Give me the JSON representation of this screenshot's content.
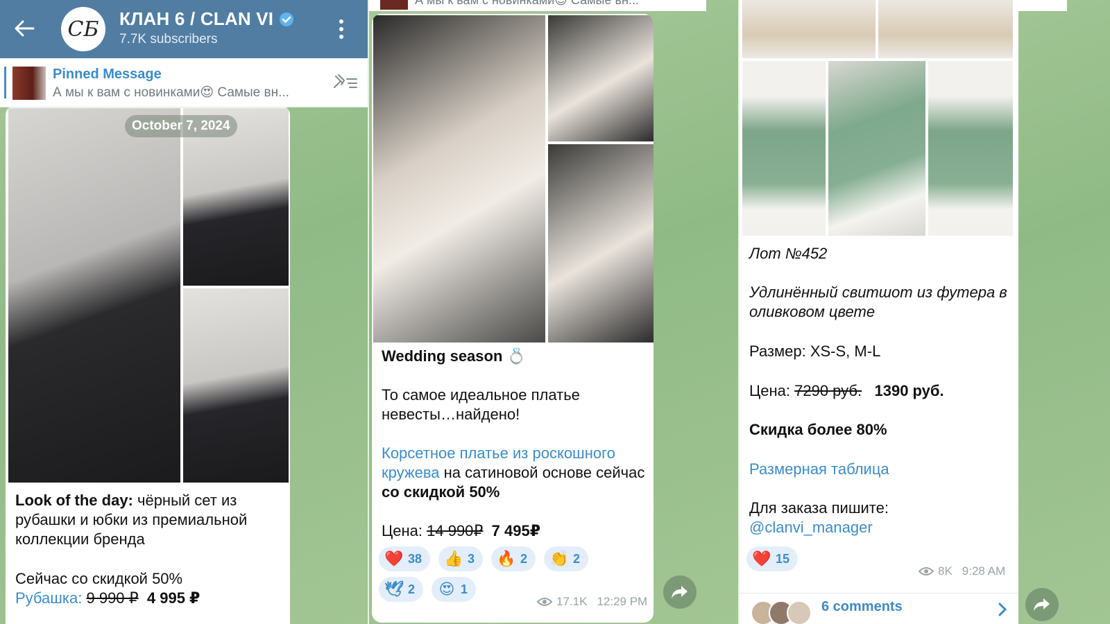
{
  "channel": {
    "back_label": "←",
    "avatar_text": "CƂ",
    "title": "КЛАН 6 / CLAN VI",
    "subscribers": "7.7K subscribers"
  },
  "pinned": {
    "title": "Pinned Message",
    "preview": "А мы к вам с новинками😍 Самые вн..."
  },
  "post1": {
    "date": "October 7, 2024",
    "lead_bold": "Look of the day:",
    "lead_text": " чёрный сет из рубашки и юбки из премиальной коллекции бренда",
    "discount_line": "Сейчас со скидкой 50%",
    "item_link": "Рубашка:",
    "old_price": "9 990 ₽",
    "new_price": "4 995 ₽"
  },
  "post2": {
    "heading": "Wedding season 💍",
    "paragraph": "То самое идеальное платье невесты…найдено!",
    "link_text": "Корсетное платье из роскошного кружева",
    "after_link": " на сатиновой основе сейчас ",
    "after_link_bold": "со скидкой 50%",
    "price_label": "Цена: ",
    "old_price": "14 990₽",
    "new_price": "7 495₽",
    "reactions": [
      {
        "emoji": "❤️",
        "count": "38"
      },
      {
        "emoji": "👍",
        "count": "3"
      },
      {
        "emoji": "🔥",
        "count": "2"
      },
      {
        "emoji": "👏",
        "count": "2"
      },
      {
        "emoji": "🕊",
        "count": "2"
      },
      {
        "emoji": "😍",
        "count": "1"
      }
    ],
    "views": "17.1K",
    "time": "12:29 PM"
  },
  "post3": {
    "lot": "Лот №452",
    "title": "Удлинённый свитшот из футера в оливковом цвете",
    "size": "Размер: XS-S, M-L",
    "price_label": "Цена: ",
    "old_price": "7290 руб.",
    "new_price": "1390 руб.",
    "discount": "Скидка более 80%",
    "size_table_link": "Размерная таблица",
    "order_label": "Для заказа пишите:",
    "order_handle": "@clanvi_manager",
    "reaction": {
      "emoji": "❤️",
      "count": "15"
    },
    "views": "8K",
    "time": "9:28 AM",
    "comments": "6 comments"
  },
  "colors": {
    "header_bg": "#517da2",
    "link": "#3d8bc6",
    "reaction_bg": "#e3eefa",
    "chat_bg": "#9cc08e"
  }
}
